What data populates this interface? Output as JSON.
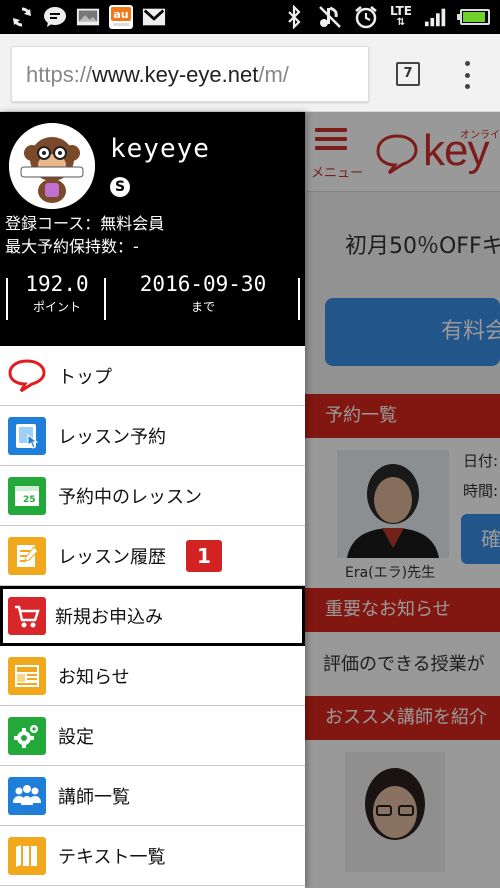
{
  "status_bar": {
    "network": "LTE",
    "battery_level": 0.9,
    "accent_battery": "#6fd12a"
  },
  "browser": {
    "url_scheme": "https://",
    "url_host": "www.key-eye.net",
    "url_path": "/m/",
    "tab_count": "7"
  },
  "drawer": {
    "username": "keyeye",
    "skype_glyph": "S",
    "course_line": "登録コース：無料会員",
    "reserve_line": "最大予約保持数：-",
    "points_value": "192.0",
    "points_label": "ポイント",
    "expiry_value": "2016-09-30",
    "expiry_label": "まで",
    "items": [
      {
        "label": "トップ",
        "icon": "speech-bubble-icon"
      },
      {
        "label": "レッスン予約",
        "icon": "tablet-touch-icon"
      },
      {
        "label": "予約中のレッスン",
        "icon": "calendar-icon"
      },
      {
        "label": "レッスン履歴",
        "icon": "notepad-icon",
        "badge": "1"
      },
      {
        "label": "新規お申込み",
        "icon": "cart-icon"
      },
      {
        "label": "お知らせ",
        "icon": "news-icon"
      },
      {
        "label": "設定",
        "icon": "gears-icon"
      },
      {
        "label": "講師一覧",
        "icon": "people-icon"
      },
      {
        "label": "テキスト一覧",
        "icon": "books-icon"
      }
    ]
  },
  "background_page": {
    "menu_label": "メニュー",
    "logo_text": "key",
    "logo_sub": "オンライン",
    "promo": "初月50％OFFキ",
    "paid_button": "有料会",
    "reservations_header": "予約一覧",
    "teacher_name": "Era(エラ)先生",
    "date_label": "日付:",
    "time_label": "時間:",
    "confirm_button": "確",
    "notice_header": "重要なお知らせ",
    "notice_text": "評価のできる授業が",
    "recommend_header": "おススメ講師を紹介"
  },
  "colors": {
    "brand_red": "#d9251c",
    "brand_blue": "#3a8ee6"
  }
}
